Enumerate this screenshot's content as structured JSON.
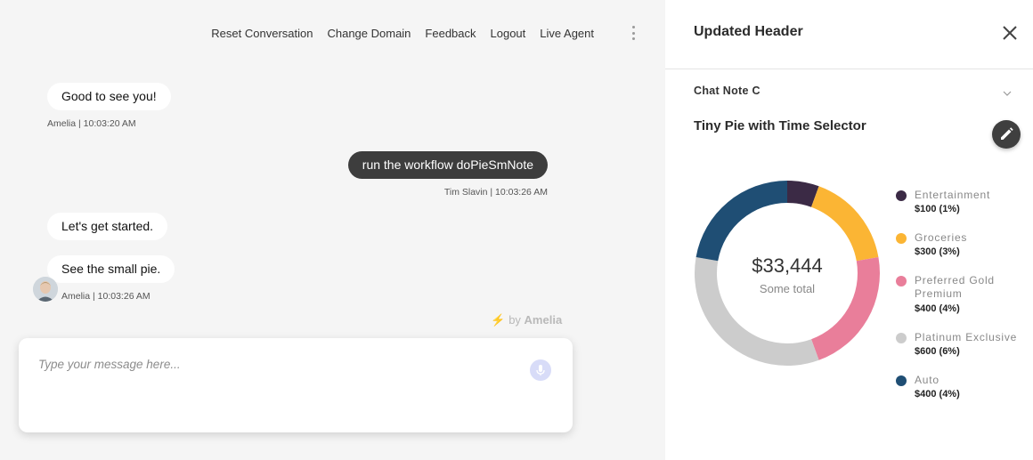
{
  "nav": {
    "items": [
      "Reset Conversation",
      "Change Domain",
      "Feedback",
      "Logout",
      "Live Agent"
    ]
  },
  "messages": [
    {
      "text": "Good to see you!",
      "sender": "bot"
    },
    {
      "text": "run the workflow doPieSmNote",
      "sender": "user"
    },
    {
      "text": "Let's get started.",
      "sender": "bot"
    },
    {
      "text": "See the small pie.",
      "sender": "bot"
    }
  ],
  "meta": {
    "first": "Amelia | 10:03:20 AM",
    "user": "Tim Slavin | 10:03:26 AM",
    "last": "Amelia | 10:03:26 AM"
  },
  "branding": {
    "by": "by",
    "name": "Amelia"
  },
  "composer": {
    "placeholder": "Type your message here..."
  },
  "panel": {
    "title": "Updated Header",
    "note_label": "Chat Note C",
    "chart_title": "Tiny Pie with Time Selector"
  },
  "icons": [
    "more-vert-icon",
    "user-avatar",
    "lightning-bolt-icon",
    "microphone-icon",
    "close-icon",
    "chevron-down-icon",
    "pencil-edit-icon"
  ],
  "colors": {
    "user_bubble": "#3d3d3d",
    "mic": "#d8dcf8",
    "bolt": "#f5c15a"
  },
  "chart_data": {
    "type": "pie",
    "donut": true,
    "title": "Tiny Pie with Time Selector",
    "center_value": "$33,444",
    "center_label": "Some total",
    "series": [
      {
        "name": "Entertainment",
        "value": 100,
        "label": "$100 (1%)",
        "color": "#3b2a45"
      },
      {
        "name": "Groceries",
        "value": 300,
        "label": "$300 (3%)",
        "color": "#fbb534"
      },
      {
        "name": "Preferred Gold Premium",
        "value": 400,
        "label": "$400 (4%)",
        "color": "#e97e9a"
      },
      {
        "name": "Platinum Exclusive",
        "value": 600,
        "label": "$600 (6%)",
        "color": "#cccccc"
      },
      {
        "name": "Auto",
        "value": 400,
        "label": "$400 (4%)",
        "color": "#1f4e74"
      }
    ],
    "legend_position": "right"
  }
}
